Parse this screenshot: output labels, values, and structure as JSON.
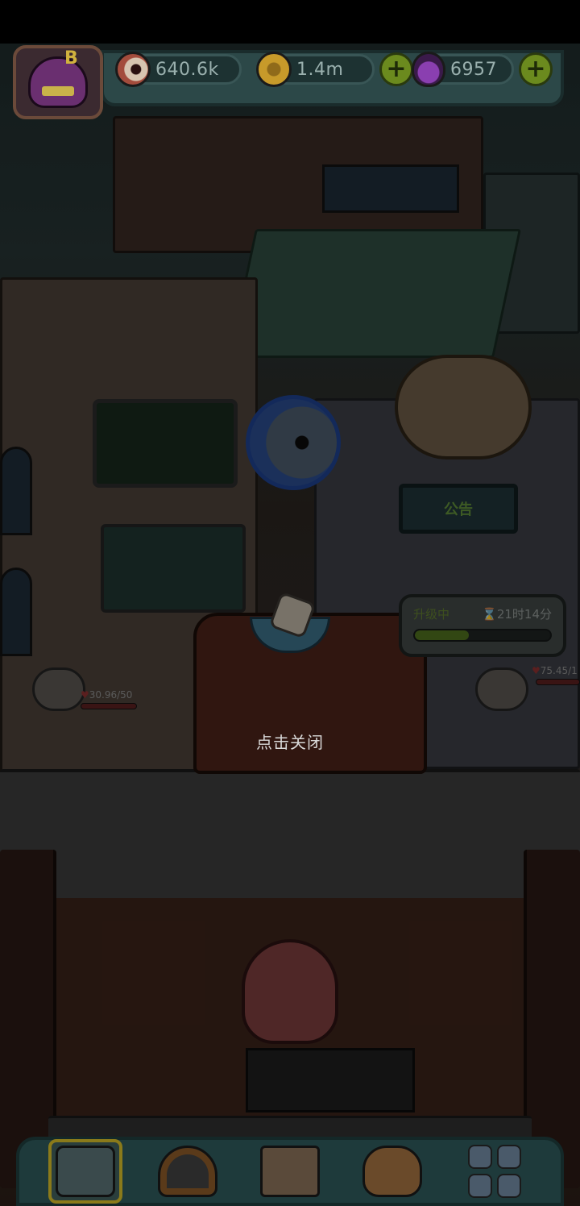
{
  "hud": {
    "resources": [
      {
        "id": "eyes",
        "icon": "eyeball-icon",
        "value": "640.6k"
      },
      {
        "id": "coins",
        "icon": "coin-icon",
        "value": "1.4m"
      },
      {
        "id": "potions",
        "icon": "potion-icon",
        "value": "6957"
      }
    ],
    "avatar_badge": "B",
    "plus_symbol": "+"
  },
  "scene": {
    "notice_board": "公告",
    "upgrade": {
      "label": "升级中",
      "timer": "21时14分",
      "progress": 0.4
    },
    "customers": [
      {
        "hp": "30.96/50"
      },
      {
        "hp": "75.45/1"
      }
    ],
    "close_hint": "点击关闭"
  },
  "bottom_nav": [
    {
      "id": "shop",
      "icon": "shop-icon",
      "active": true
    },
    {
      "id": "monster",
      "icon": "monster-icon",
      "active": false
    },
    {
      "id": "recipe",
      "icon": "recipe-book-icon",
      "active": false
    },
    {
      "id": "bag",
      "icon": "money-bag-icon",
      "active": false
    },
    {
      "id": "more",
      "icon": "grid-menu-icon",
      "active": false
    }
  ]
}
